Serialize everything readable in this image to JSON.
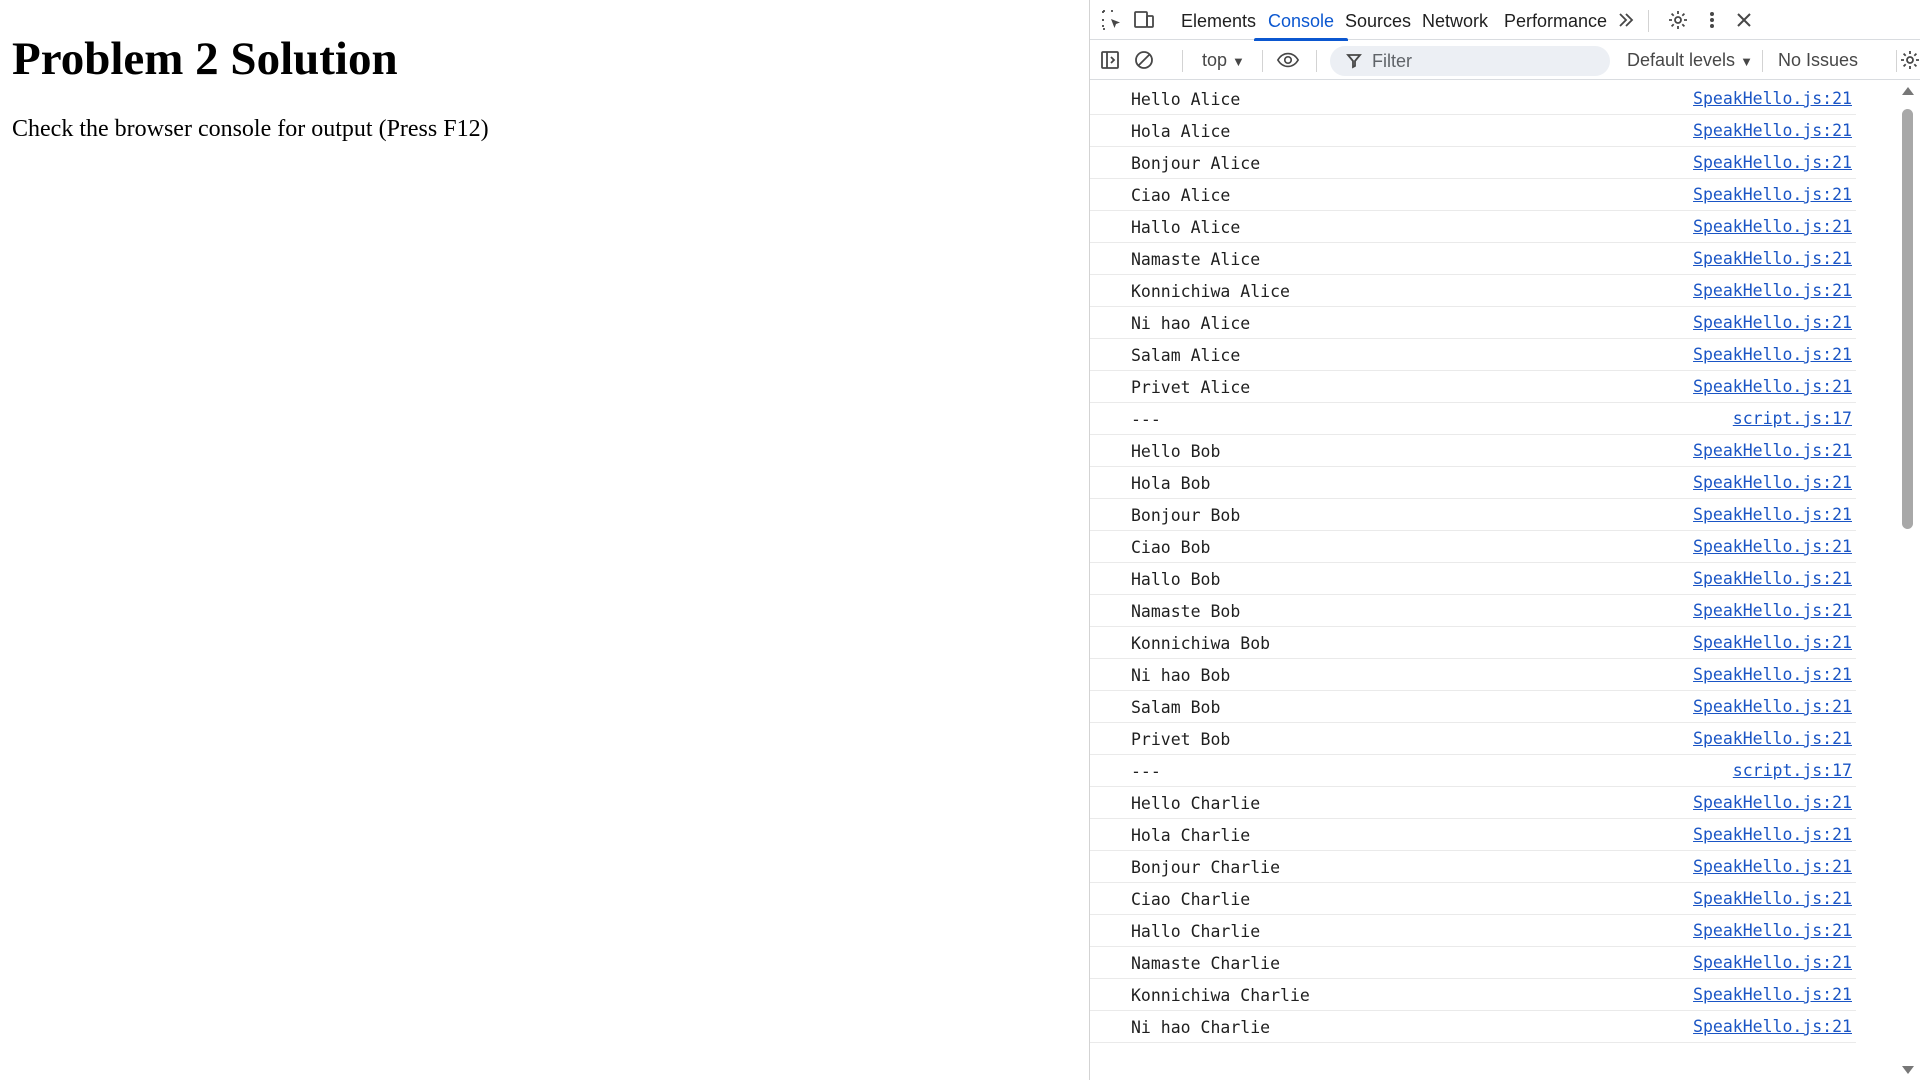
{
  "page": {
    "heading": "Problem 2 Solution",
    "instruction": "Check the browser console for output (Press F12)"
  },
  "devtools": {
    "tabs": [
      "Elements",
      "Console",
      "Sources",
      "Network",
      "Performance"
    ],
    "active_tab": "Console",
    "overflow_icon": "double-chevron-right-icon",
    "toolbar": {
      "context": "top",
      "filter_placeholder": "Filter",
      "levels": "Default levels",
      "issues": "No Issues"
    },
    "console_rows": [
      {
        "message": "Hello Alice",
        "source": "SpeakHello.js:21"
      },
      {
        "message": "Hola Alice",
        "source": "SpeakHello.js:21"
      },
      {
        "message": "Bonjour Alice",
        "source": "SpeakHello.js:21"
      },
      {
        "message": "Ciao Alice",
        "source": "SpeakHello.js:21"
      },
      {
        "message": "Hallo Alice",
        "source": "SpeakHello.js:21"
      },
      {
        "message": "Namaste Alice",
        "source": "SpeakHello.js:21"
      },
      {
        "message": "Konnichiwa Alice",
        "source": "SpeakHello.js:21"
      },
      {
        "message": "Ni hao Alice",
        "source": "SpeakHello.js:21"
      },
      {
        "message": "Salam Alice",
        "source": "SpeakHello.js:21"
      },
      {
        "message": "Privet Alice",
        "source": "SpeakHello.js:21"
      },
      {
        "message": "---",
        "source": "script.js:17"
      },
      {
        "message": "Hello Bob",
        "source": "SpeakHello.js:21"
      },
      {
        "message": "Hola Bob",
        "source": "SpeakHello.js:21"
      },
      {
        "message": "Bonjour Bob",
        "source": "SpeakHello.js:21"
      },
      {
        "message": "Ciao Bob",
        "source": "SpeakHello.js:21"
      },
      {
        "message": "Hallo Bob",
        "source": "SpeakHello.js:21"
      },
      {
        "message": "Namaste Bob",
        "source": "SpeakHello.js:21"
      },
      {
        "message": "Konnichiwa Bob",
        "source": "SpeakHello.js:21"
      },
      {
        "message": "Ni hao Bob",
        "source": "SpeakHello.js:21"
      },
      {
        "message": "Salam Bob",
        "source": "SpeakHello.js:21"
      },
      {
        "message": "Privet Bob",
        "source": "SpeakHello.js:21"
      },
      {
        "message": "---",
        "source": "script.js:17"
      },
      {
        "message": "Hello Charlie",
        "source": "SpeakHello.js:21"
      },
      {
        "message": "Hola Charlie",
        "source": "SpeakHello.js:21"
      },
      {
        "message": "Bonjour Charlie",
        "source": "SpeakHello.js:21"
      },
      {
        "message": "Ciao Charlie",
        "source": "SpeakHello.js:21"
      },
      {
        "message": "Hallo Charlie",
        "source": "SpeakHello.js:21"
      },
      {
        "message": "Namaste Charlie",
        "source": "SpeakHello.js:21"
      },
      {
        "message": "Konnichiwa Charlie",
        "source": "SpeakHello.js:21"
      },
      {
        "message": "Ni hao Charlie",
        "source": "SpeakHello.js:21"
      }
    ]
  },
  "colors": {
    "accent": "#0b57d0",
    "link": "#1a55c5",
    "text": "#1f1f1f"
  }
}
